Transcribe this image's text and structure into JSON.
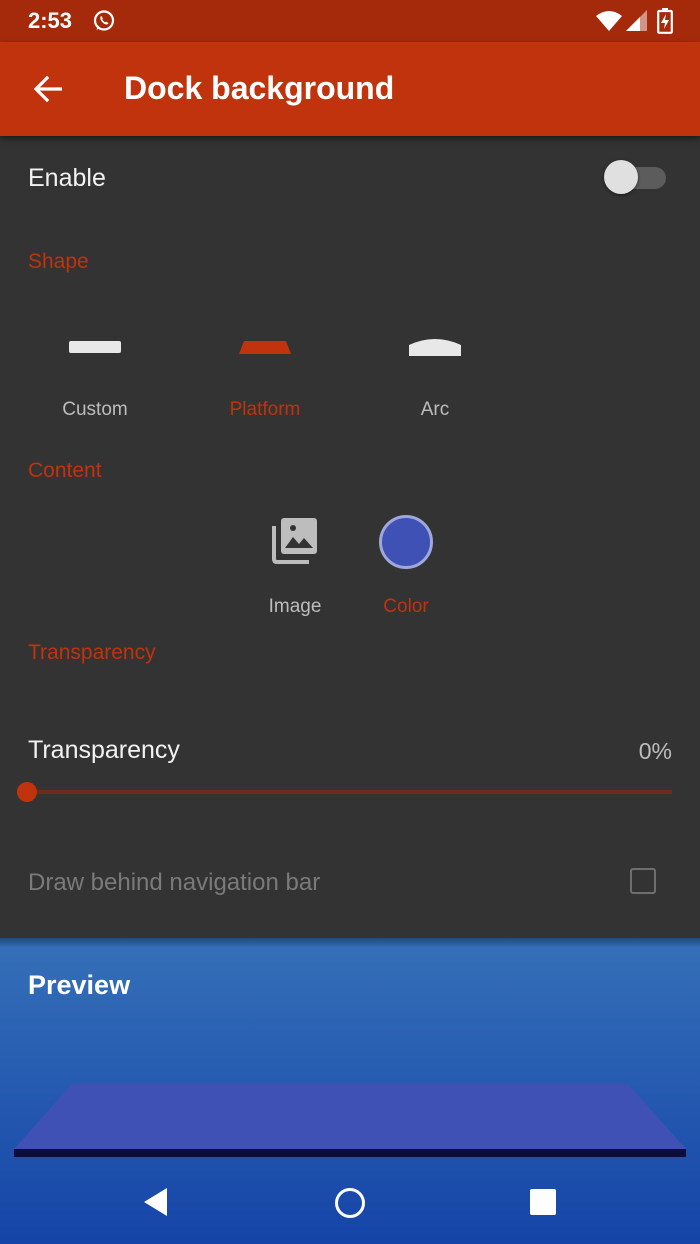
{
  "status_bar": {
    "time": "2:53"
  },
  "app_bar": {
    "title": "Dock background"
  },
  "enable": {
    "label": "Enable",
    "on": false
  },
  "shape": {
    "title": "Shape",
    "options": [
      {
        "label": "Custom",
        "selected": false
      },
      {
        "label": "Platform",
        "selected": true
      },
      {
        "label": "Arc",
        "selected": false
      }
    ]
  },
  "content": {
    "title": "Content",
    "options": [
      {
        "label": "Image",
        "selected": false
      },
      {
        "label": "Color",
        "selected": true
      }
    ],
    "color_swatch": "#3f51b5"
  },
  "transparency": {
    "title": "Transparency",
    "label": "Transparency",
    "value_text": "0%",
    "value": 0
  },
  "draw_behind": {
    "label": "Draw behind navigation bar",
    "checked": false
  },
  "preview": {
    "title": "Preview"
  },
  "colors": {
    "accent": "#c0330c",
    "status_bar": "#a52a0b",
    "background": "#333333",
    "dock": "#3f51b5"
  }
}
